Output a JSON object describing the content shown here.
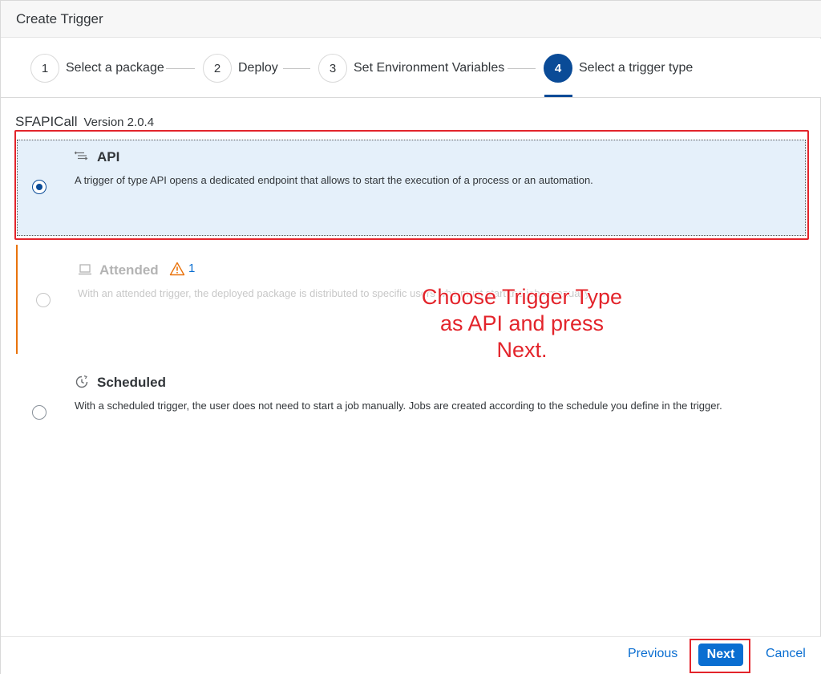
{
  "dialog": {
    "title": "Create Trigger"
  },
  "wizard": {
    "steps": [
      {
        "number": "1",
        "label": "Select a package"
      },
      {
        "number": "2",
        "label": "Deploy"
      },
      {
        "number": "3",
        "label": "Set Environment Variables"
      },
      {
        "number": "4",
        "label": "Select a trigger type"
      }
    ],
    "active_step": 4
  },
  "package": {
    "name": "SFAPICall",
    "version": "Version 2.0.4"
  },
  "options": {
    "api": {
      "title": "API",
      "description": "A trigger of type API opens a dedicated endpoint that allows to start the execution of a process or an automation.",
      "selected": true,
      "icon": "api-icon"
    },
    "attended": {
      "title": "Attended",
      "description": "With an attended trigger, the deployed package is distributed to specific users who must start the jobs manually.",
      "warning_count": "1",
      "disabled": true,
      "icon": "laptop-icon"
    },
    "scheduled": {
      "title": "Scheduled",
      "description": "With a scheduled trigger, the user does not need to start a job manually. Jobs are created according to the schedule you define in the trigger.",
      "selected": false,
      "icon": "clock-icon"
    }
  },
  "annotation": {
    "line1": "Choose Trigger Type",
    "line2": "as API and press",
    "line3": "Next."
  },
  "footer": {
    "previous": "Previous",
    "next": "Next",
    "cancel": "Cancel"
  },
  "colors": {
    "accent": "#0a4b97",
    "link": "#0a6ed1",
    "annotation": "#e3242b",
    "warning": "#e9730c",
    "selected_bg": "#e5f0fa"
  }
}
